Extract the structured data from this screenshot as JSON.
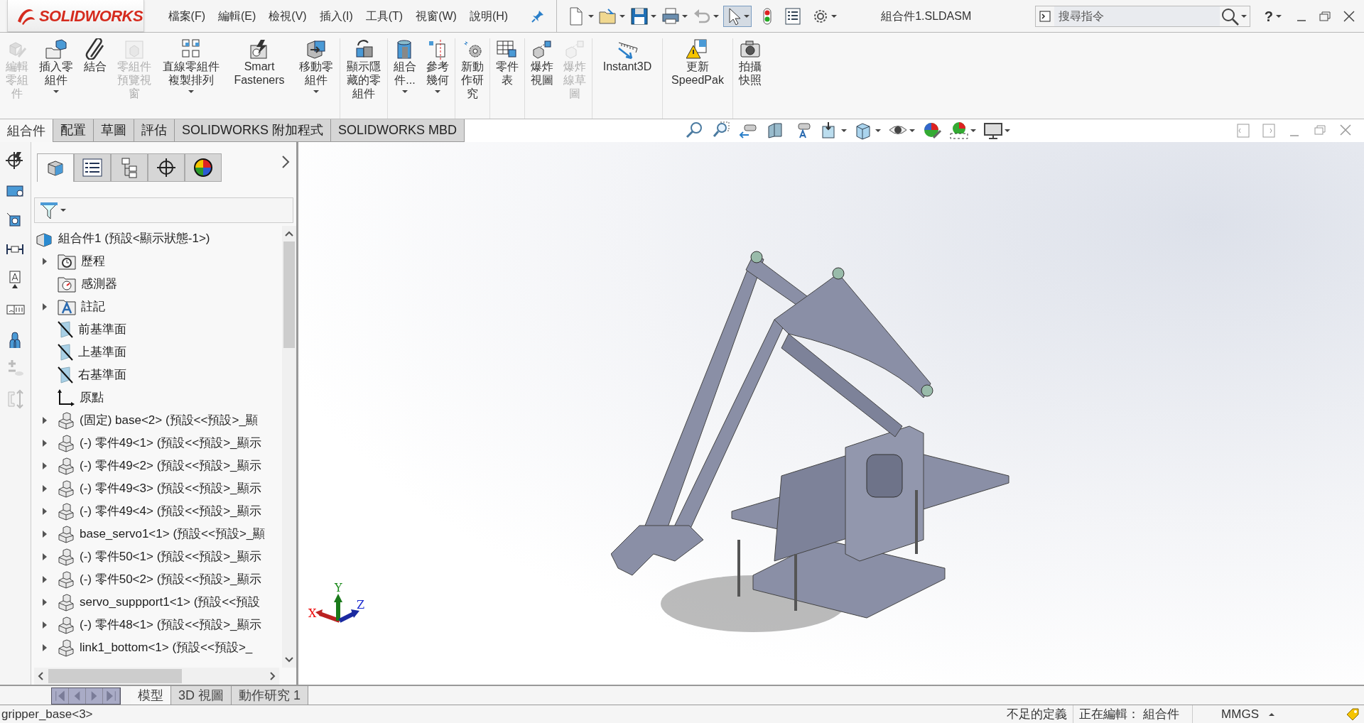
{
  "app": {
    "logo": "SOLIDWORKS",
    "menu": [
      "檔案(F)",
      "編輯(E)",
      "檢視(V)",
      "插入(I)",
      "工具(T)",
      "視窗(W)",
      "說明(H)"
    ],
    "title": "組合件1.SLDASM",
    "search": {
      "placeholder": "搜尋指令"
    },
    "help": "?"
  },
  "ribbon": {
    "groups": [
      [
        {
          "label": "編輯零組件",
          "disabled": true,
          "dropdown": false
        },
        {
          "label": "插入零組件",
          "disabled": false,
          "dropdown": true
        },
        {
          "label": "結合",
          "disabled": false,
          "dropdown": false
        },
        {
          "label": "零組件預覽視窗",
          "disabled": true,
          "dropdown": false
        },
        {
          "label": "直線零組件複製排列",
          "disabled": false,
          "dropdown": true
        },
        {
          "label": "Smart Fasteners",
          "disabled": false,
          "dropdown": false
        },
        {
          "label": "移動零組件",
          "disabled": false,
          "dropdown": true
        }
      ],
      [
        {
          "label": "顯示隱藏的零組件",
          "disabled": false,
          "dropdown": false
        }
      ],
      [
        {
          "label": "組合件...",
          "disabled": false,
          "dropdown": true
        },
        {
          "label": "參考幾何",
          "disabled": false,
          "dropdown": true
        }
      ],
      [
        {
          "label": "新動作研究",
          "disabled": false,
          "dropdown": false
        }
      ],
      [
        {
          "label": "零件表",
          "disabled": false,
          "dropdown": false
        }
      ],
      [
        {
          "label": "爆炸視圖",
          "disabled": false,
          "dropdown": false
        },
        {
          "label": "爆炸線草圖",
          "disabled": true,
          "dropdown": false
        }
      ],
      [
        {
          "label": "Instant3D",
          "disabled": false,
          "dropdown": false
        }
      ],
      [
        {
          "label": "更新SpeedPak",
          "disabled": false,
          "dropdown": false
        }
      ],
      [
        {
          "label": "拍攝快照",
          "disabled": false,
          "dropdown": false
        }
      ]
    ]
  },
  "panel_tabs": [
    {
      "selected": true
    },
    {
      "selected": false
    },
    {
      "selected": false
    },
    {
      "selected": false
    },
    {
      "selected": false
    }
  ],
  "command_tabs": [
    {
      "label": "組合件",
      "selected": true
    },
    {
      "label": "配置",
      "selected": false
    },
    {
      "label": "草圖",
      "selected": false
    },
    {
      "label": "評估",
      "selected": false
    },
    {
      "label": "SOLIDWORKS 附加程式",
      "selected": false
    },
    {
      "label": "SOLIDWORKS MBD",
      "selected": false
    }
  ],
  "feature_tree": {
    "root": {
      "label": "組合件1  (預設<顯示狀態-1>)",
      "kind": "assembly",
      "children": [
        {
          "label": "歷程",
          "kind": "history",
          "expandable": true
        },
        {
          "label": "感測器",
          "kind": "sensor",
          "expandable": false
        },
        {
          "label": "註記",
          "kind": "annotation",
          "expandable": true
        },
        {
          "label": "前基準面",
          "kind": "plane",
          "expandable": false
        },
        {
          "label": "上基準面",
          "kind": "plane",
          "expandable": false
        },
        {
          "label": "右基準面",
          "kind": "plane",
          "expandable": false
        },
        {
          "label": "原點",
          "kind": "origin",
          "expandable": false
        },
        {
          "label": "(固定) base<2> (預設<<預設>_顯",
          "kind": "part",
          "expandable": true
        },
        {
          "label": "(-) 零件49<1> (預設<<預設>_顯示",
          "kind": "part",
          "expandable": true
        },
        {
          "label": "(-) 零件49<2> (預設<<預設>_顯示",
          "kind": "part",
          "expandable": true
        },
        {
          "label": "(-) 零件49<3> (預設<<預設>_顯示",
          "kind": "part",
          "expandable": true
        },
        {
          "label": "(-) 零件49<4> (預設<<預設>_顯示",
          "kind": "part",
          "expandable": true
        },
        {
          "label": "base_servo1<1> (預設<<預設>_顯",
          "kind": "part",
          "expandable": true
        },
        {
          "label": "(-) 零件50<1> (預設<<預設>_顯示",
          "kind": "part",
          "expandable": true
        },
        {
          "label": "(-) 零件50<2> (預設<<預設>_顯示",
          "kind": "part",
          "expandable": true
        },
        {
          "label": "servo_suppport1<1> (預設<<預設",
          "kind": "part",
          "expandable": true
        },
        {
          "label": "(-) 零件48<1> (預設<<預設>_顯示",
          "kind": "part",
          "expandable": true
        },
        {
          "label": "link1_bottom<1> (預設<<預設>_",
          "kind": "part",
          "expandable": true
        }
      ]
    }
  },
  "triad": {
    "x": "X",
    "y": "Y",
    "z": "Z"
  },
  "bottom_tabs": [
    {
      "label": "模型",
      "selected": true
    },
    {
      "label": "3D 視圖",
      "selected": false
    },
    {
      "label": "動作研究 1",
      "selected": false
    }
  ],
  "status_bar": {
    "selection": "gripper_base<3>",
    "definition": "不足的定義",
    "editing": "正在編輯： 組合件",
    "units": "MMGS"
  }
}
